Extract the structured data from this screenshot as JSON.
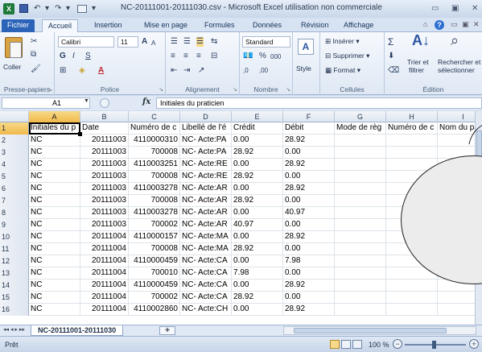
{
  "window": {
    "title": "NC-20111001-20111030.csv - Microsoft Excel utilisation non commerciale",
    "app_icon": "X",
    "controls": [
      "▭",
      "▣",
      "✕"
    ]
  },
  "qat": {
    "undo": "↶",
    "redo": "↷",
    "more": "▾"
  },
  "tabs": [
    {
      "label": "Fichier"
    },
    {
      "label": "Accueil"
    },
    {
      "label": "Insertion"
    },
    {
      "label": "Mise en page"
    },
    {
      "label": "Formules"
    },
    {
      "label": "Données"
    },
    {
      "label": "Révision"
    },
    {
      "label": "Affichage"
    }
  ],
  "ribbon": {
    "clipboard": {
      "paste_label": "Coller",
      "label": "Presse-papiers"
    },
    "font": {
      "name": "Calibri",
      "size": "11",
      "bold": "G",
      "italic": "I",
      "underline": "S",
      "grow": "A",
      "shrink": "A",
      "label": "Police",
      "fill_letter": "A"
    },
    "alignment": {
      "label": "Alignement"
    },
    "number": {
      "format": "Standard",
      "percent": "%",
      "thousands": "000",
      "dec_inc": ",0",
      "dec_dec": ",00",
      "label": "Nombre"
    },
    "styles": {
      "label": "Style",
      "letter": "A"
    },
    "cells": {
      "insert": "Insérer",
      "delete": "Supprimer",
      "format": "Format",
      "label": "Cellules"
    },
    "editing": {
      "sigma": "Σ",
      "sort_line1": "Trier et",
      "sort_line2": "filtrer",
      "find_line1": "Rechercher et",
      "find_line2": "sélectionner",
      "label": "Édition"
    }
  },
  "formula_bar": {
    "name_box": "A1",
    "fx": "fx",
    "value": "Initiales du praticien"
  },
  "columns": [
    "A",
    "B",
    "C",
    "D",
    "E",
    "F",
    "G",
    "H",
    "I"
  ],
  "rows": [
    {
      "n": "1",
      "cells": [
        "Initiales du p",
        "Date",
        "Numéro de c",
        "Libellé de l'é",
        "Crédit",
        "Débit",
        "Mode de règ",
        "Numéro de c",
        "Nom du pa"
      ]
    },
    {
      "n": "2",
      "cells": [
        "NC",
        "20111003",
        "4110000310",
        "NC- Acte:PA",
        "0.00",
        "28.92",
        "",
        "",
        ""
      ]
    },
    {
      "n": "3",
      "cells": [
        "NC",
        "20111003",
        "700008",
        "NC- Acte:PA",
        "28.92",
        "0.00",
        "",
        "",
        ""
      ]
    },
    {
      "n": "4",
      "cells": [
        "NC",
        "20111003",
        "4110003251",
        "NC- Acte:RE",
        "0.00",
        "28.92",
        "",
        "",
        ""
      ]
    },
    {
      "n": "5",
      "cells": [
        "NC",
        "20111003",
        "700008",
        "NC- Acte:RE",
        "28.92",
        "0.00",
        "",
        "",
        ""
      ]
    },
    {
      "n": "6",
      "cells": [
        "NC",
        "20111003",
        "4110003278",
        "NC- Acte:AR",
        "0.00",
        "28.92",
        "",
        "",
        ""
      ]
    },
    {
      "n": "7",
      "cells": [
        "NC",
        "20111003",
        "700008",
        "NC- Acte:AR",
        "28.92",
        "0.00",
        "",
        "",
        ""
      ]
    },
    {
      "n": "8",
      "cells": [
        "NC",
        "20111003",
        "4110003278",
        "NC- Acte:AR",
        "0.00",
        "40.97",
        "",
        "",
        ""
      ]
    },
    {
      "n": "9",
      "cells": [
        "NC",
        "20111003",
        "700002",
        "NC- Acte:AR",
        "40.97",
        "0.00",
        "",
        "",
        ""
      ]
    },
    {
      "n": "10",
      "cells": [
        "NC",
        "20111004",
        "4110000157",
        "NC- Acte:MA",
        "0.00",
        "28.92",
        "",
        "",
        ""
      ]
    },
    {
      "n": "11",
      "cells": [
        "NC",
        "20111004",
        "700008",
        "NC- Acte:MA",
        "28.92",
        "0.00",
        "",
        "",
        ""
      ]
    },
    {
      "n": "12",
      "cells": [
        "NC",
        "20111004",
        "4110000459",
        "NC- Acte:CA",
        "0.00",
        "7.98",
        "",
        "",
        ""
      ]
    },
    {
      "n": "13",
      "cells": [
        "NC",
        "20111004",
        "700010",
        "NC- Acte:CA",
        "7.98",
        "0.00",
        "",
        "",
        ""
      ]
    },
    {
      "n": "14",
      "cells": [
        "NC",
        "20111004",
        "4110000459",
        "NC- Acte:CA",
        "0.00",
        "28.92",
        "",
        "",
        ""
      ]
    },
    {
      "n": "15",
      "cells": [
        "NC",
        "20111004",
        "700002",
        "NC- Acte:CA",
        "28.92",
        "0.00",
        "",
        "",
        ""
      ]
    },
    {
      "n": "16",
      "cells": [
        "NC",
        "20111004",
        "4110002860",
        "NC- Acte:CH",
        "0.00",
        "28.92",
        "",
        "",
        ""
      ]
    }
  ],
  "sheet": {
    "tab": "NC-20111001-20111030",
    "nav": "◂◂ ◂ ▸ ▸▸"
  },
  "status": {
    "text": "Prêt",
    "zoom": "100 %",
    "zoom_level_percent": 100,
    "minus": "−",
    "plus": "+"
  },
  "colors": {
    "file_tab": "#2a63b8",
    "selected_header": "#f0b94a",
    "excel_green": "#1e7a3a"
  }
}
